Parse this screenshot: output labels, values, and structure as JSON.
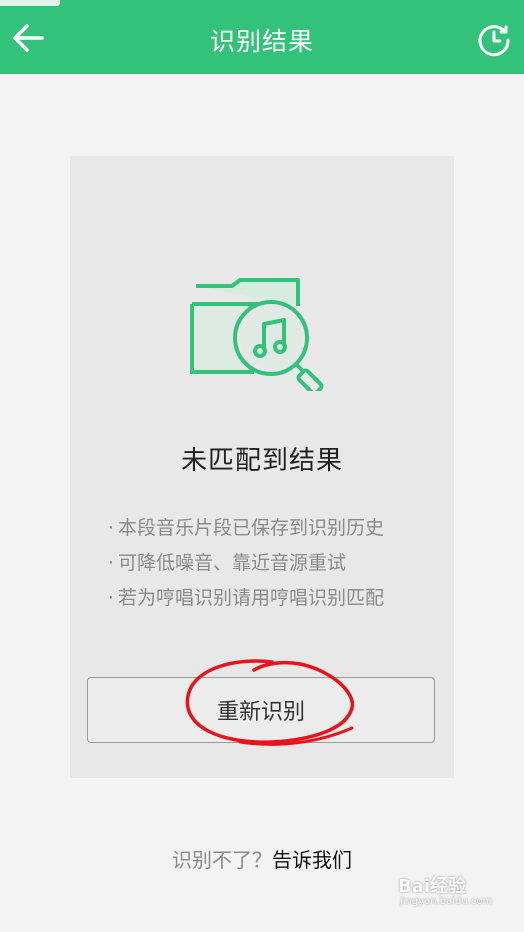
{
  "header": {
    "title": "识别结果",
    "back_icon": "arrow-left-icon",
    "history_icon": "clock-history-icon",
    "background": "#33c27a"
  },
  "result": {
    "illustration_icon": "music-folder-search-icon",
    "title": "未匹配到结果",
    "tips": [
      "本段音乐片段已保存到识别历史",
      "可降低噪音、靠近音源重试",
      "若为哼唱识别请用哼唱识别匹配"
    ],
    "tip_bullet": "·",
    "retry_label": "重新识别",
    "accent": "#33c27a"
  },
  "footer": {
    "question": "识别不了？",
    "link": "告诉我们"
  },
  "watermark": {
    "brand": "Bai经验",
    "url": "jingyan.baidu.com"
  }
}
